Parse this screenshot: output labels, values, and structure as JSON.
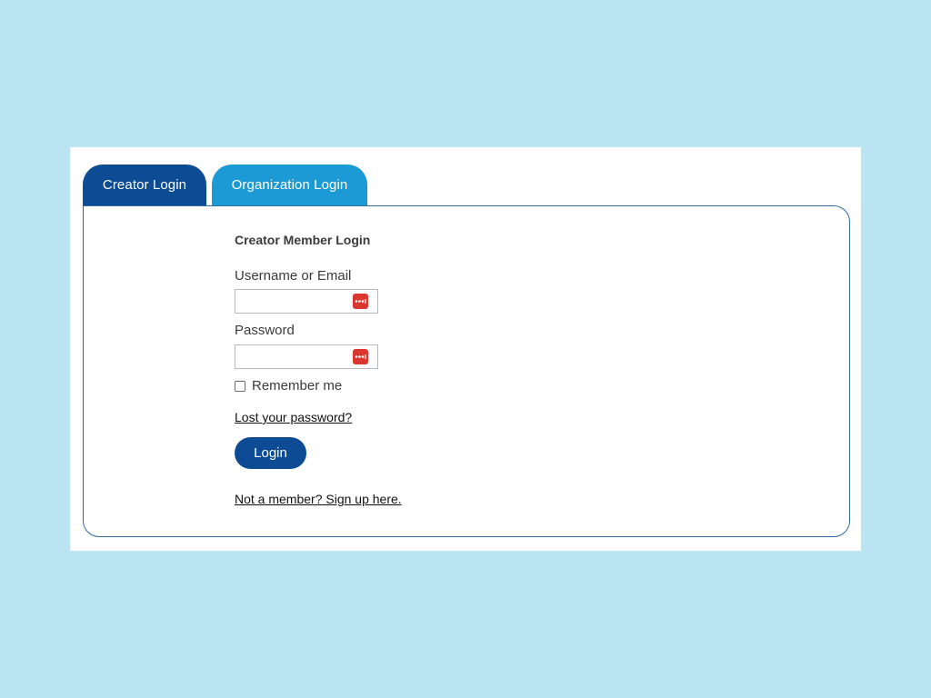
{
  "tabs": {
    "creator_label": "Creator Login",
    "organization_label": "Organization Login",
    "active": "Creator Login"
  },
  "form": {
    "title": "Creator Member Login",
    "username_label": "Username or Email",
    "username_value": "",
    "password_label": "Password",
    "password_value": "",
    "remember_label": "Remember me",
    "remember_checked": false,
    "lost_password_link": "Lost your password?",
    "login_button": "Login",
    "signup_link": "Not a member? Sign up here."
  },
  "icons": {
    "password_manager": "password-manager-icon",
    "checkbox": "checkbox-icon"
  },
  "colors": {
    "page_background": "#bbe4f2",
    "active_tab": "#0d4c94",
    "inactive_tab": "#1b9ad6",
    "panel_border": "#2f69a6",
    "login_button": "#0d4c94",
    "password_manager_icon": "#d9372f"
  }
}
